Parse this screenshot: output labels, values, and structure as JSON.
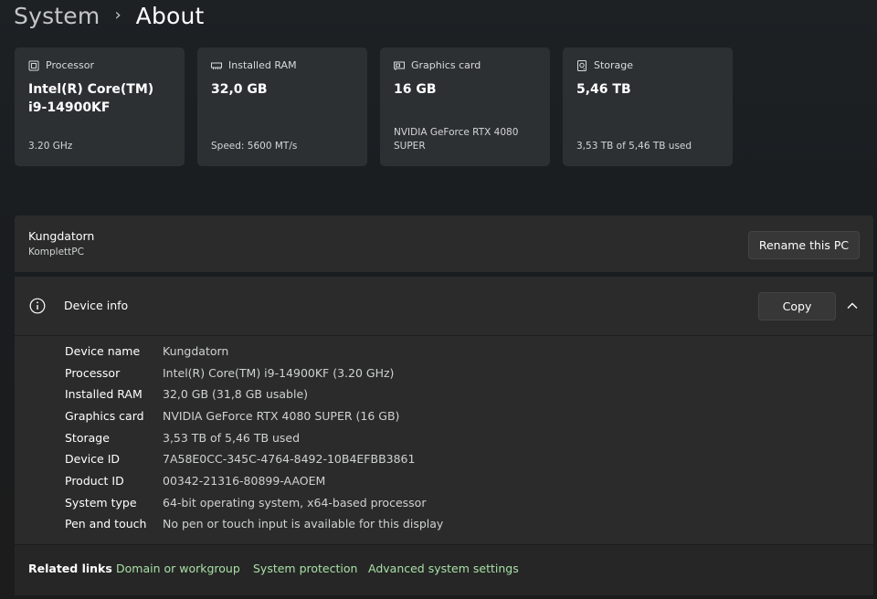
{
  "breadcrumb": {
    "parent": "System",
    "separator": "›",
    "current": "About"
  },
  "cards": {
    "processor": {
      "label": "Processor",
      "icon": "processor-chip-icon",
      "value": "Intel(R) Core(TM) i9-14900KF",
      "sub": "3.20 GHz"
    },
    "ram": {
      "label": "Installed RAM",
      "icon": "memory-icon",
      "value": "32,0 GB",
      "sub": "Speed: 5600 MT/s"
    },
    "graphics": {
      "label": "Graphics card",
      "icon": "graphics-card-icon",
      "value": "16 GB",
      "sub": "NVIDIA GeForce RTX 4080 SUPER"
    },
    "storage": {
      "label": "Storage",
      "icon": "storage-drive-icon",
      "value": "5,46 TB",
      "sub": "3,53 TB of 5,46 TB used"
    }
  },
  "pc": {
    "name": "Kungdatorn",
    "model": "KomplettPC",
    "rename_label": "Rename this PC"
  },
  "device_info": {
    "title": "Device info",
    "copy_label": "Copy",
    "rows": [
      {
        "label": "Device name",
        "value": "Kungdatorn"
      },
      {
        "label": "Processor",
        "value": "Intel(R) Core(TM) i9-14900KF (3.20 GHz)"
      },
      {
        "label": "Installed RAM",
        "value": "32,0 GB (31,8 GB usable)"
      },
      {
        "label": "Graphics card",
        "value": "NVIDIA GeForce RTX 4080 SUPER (16 GB)"
      },
      {
        "label": "Storage",
        "value": "3,53 TB of 5,46 TB used"
      },
      {
        "label": "Device ID",
        "value": "7A58E0CC-345C-4764-8492-10B4EFBB3861"
      },
      {
        "label": "Product ID",
        "value": "00342-21316-80899-AAOEM"
      },
      {
        "label": "System type",
        "value": "64-bit operating system, x64-based processor"
      },
      {
        "label": "Pen and touch",
        "value": "No pen or touch input is available for this display"
      }
    ]
  },
  "related": {
    "title": "Related links",
    "links": [
      "Domain or workgroup",
      "System protection",
      "Advanced system settings"
    ]
  },
  "colors": {
    "link": "#a8e0a6",
    "card_bg": "#2c3033",
    "panel_bg": "#2b2b2b"
  }
}
